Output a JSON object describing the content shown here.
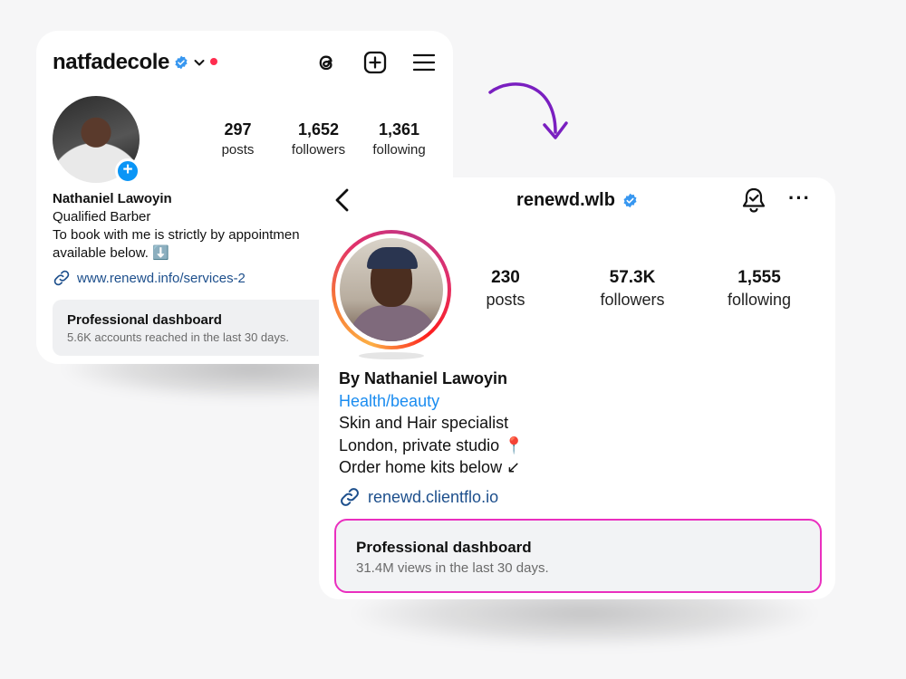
{
  "accent": {
    "verified": "#3897f0",
    "link": "#1d4f8c",
    "category": "#1a8cf0",
    "highlight_border": "#ea2fbf",
    "notification_dot": "#ff2d4f",
    "arrow": "#7a1fc0"
  },
  "old_profile": {
    "username": "natfadecole",
    "icons": [
      "verified-badge-icon",
      "chevron-down-icon",
      "threads-icon",
      "plus-square-icon",
      "menu-icon"
    ],
    "stats": [
      {
        "value": "297",
        "label": "posts"
      },
      {
        "value": "1,652",
        "label": "followers"
      },
      {
        "value": "1,361",
        "label": "following"
      }
    ],
    "name": "Nathaniel Lawoyin",
    "bio_lines": [
      "Qualified Barber",
      "To book with me is strictly by appointmen",
      "available below. ⬇️"
    ],
    "link": "www.renewd.info/services-2",
    "dashboard": {
      "title": "Professional dashboard",
      "subtitle": "5.6K accounts reached in the last 30 days."
    }
  },
  "new_profile": {
    "username": "renewd.wlb",
    "icons": [
      "back-arrow-icon",
      "verified-badge-icon",
      "bell-check-icon",
      "more-icon"
    ],
    "more_label": "···",
    "stats": [
      {
        "value": "230",
        "label": "posts"
      },
      {
        "value": "57.3K",
        "label": "followers"
      },
      {
        "value": "1,555",
        "label": "following"
      }
    ],
    "name": "By Nathaniel Lawoyin",
    "category": "Health/beauty",
    "bio_lines": [
      "Skin and Hair specialist",
      "London, private studio 📍",
      "Order home kits below ↙"
    ],
    "link": "renewd.clientflo.io",
    "dashboard": {
      "title": "Professional dashboard",
      "subtitle": "31.4M views in the last 30 days."
    }
  }
}
